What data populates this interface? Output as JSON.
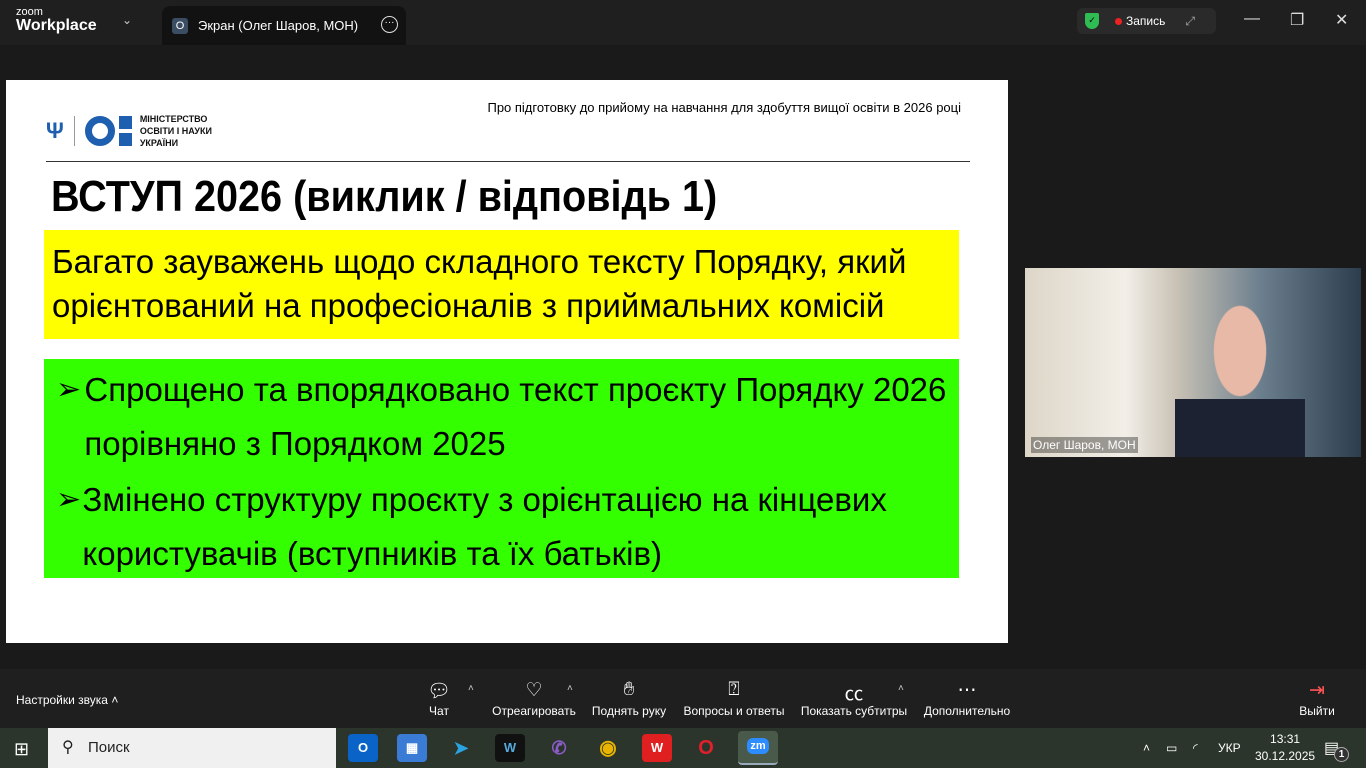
{
  "app": {
    "brand_top": "zoom",
    "brand": "Workplace",
    "tab_avatar": "O",
    "tab_title": "Экран (Олег Шаров, МОН)",
    "recording": "Запись"
  },
  "slide": {
    "ministry": [
      "МІНІСТЕРСТВО",
      "ОСВІТИ І НАУКИ",
      "УКРАЇНИ"
    ],
    "header": "Про підготовку до прийому  на навчання для здобуття вищої освіти в 2026 році",
    "title": "ВСТУП 2026 (виклик / відповідь 1)",
    "challenge": "Багато зауважень щодо складного тексту Порядку, який орієнтований на професіоналів з приймальних комісій",
    "bullets": [
      "Спрощено та впорядковано текст проєкту Порядку 2026 порівняно з Порядком 2025",
      "Змінено структуру проєкту з орієнтацією на кінцевих користувачів (вступників та їх батьків)"
    ],
    "bullet_glyph": "➢"
  },
  "video": {
    "name": "Олег Шаров, МОН"
  },
  "toolbar": {
    "sound": "Настройки звука",
    "chat": "Чат",
    "react": "Отреагировать",
    "raise": "Поднять руку",
    "qa": "Вопросы и ответы",
    "captions": "Показать субтитры",
    "more": "Дополнительно",
    "leave": "Выйти"
  },
  "taskbar": {
    "search": "Поиск",
    "lang": "УКР",
    "time": "13:31",
    "date": "30.12.2025",
    "notifications": "1"
  },
  "colors": {
    "yellow": "#ffff00",
    "green": "#33ff00",
    "moe_blue": "#1f5fb0"
  }
}
